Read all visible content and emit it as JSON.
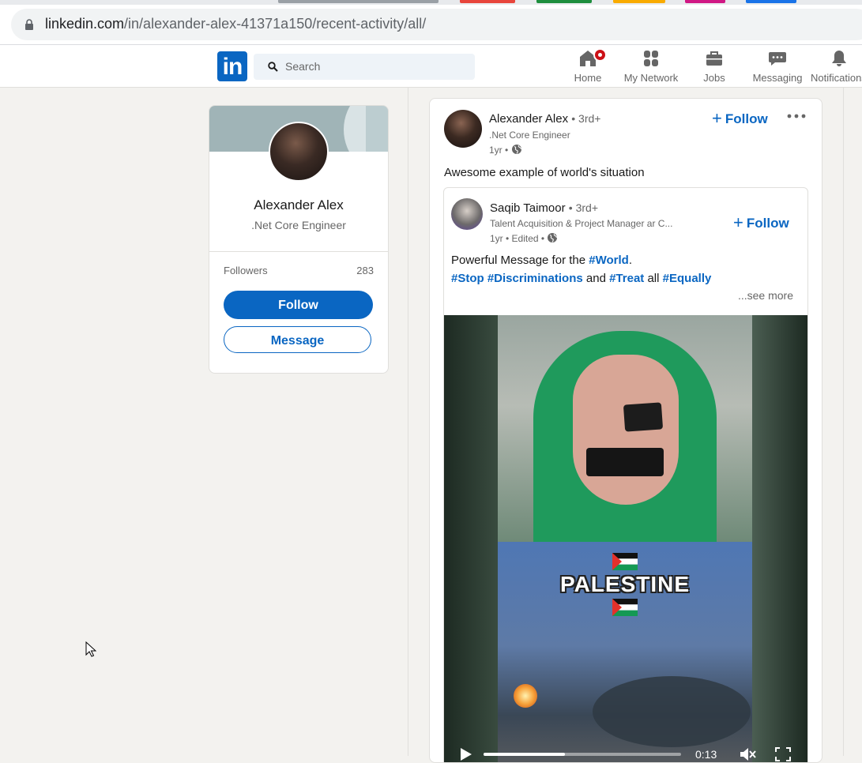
{
  "browser": {
    "url_host": "linkedin.com",
    "url_path": "/in/alexander-alex-41371a150/recent-activity/all/"
  },
  "colors": {
    "brand": "#0a66c2",
    "notification": "#cc1016",
    "background": "#f3f2ef"
  },
  "nav": {
    "search_placeholder": "Search",
    "items": [
      {
        "label": "Home",
        "icon": "home-icon",
        "badge": true
      },
      {
        "label": "My Network",
        "icon": "network-icon"
      },
      {
        "label": "Jobs",
        "icon": "briefcase-icon"
      },
      {
        "label": "Messaging",
        "icon": "messaging-icon"
      },
      {
        "label": "Notifications",
        "icon": "bell-icon"
      }
    ]
  },
  "profile": {
    "name": "Alexander Alex",
    "headline": ".Net Core Engineer",
    "followers_label": "Followers",
    "followers_count": "283",
    "follow_label": "Follow",
    "message_label": "Message"
  },
  "post": {
    "author": "Alexander Alex",
    "degree": "• 3rd+",
    "headline": ".Net Core Engineer",
    "time": "1yr •",
    "follow_label": "Follow",
    "text": "Awesome example of world's situation",
    "reshare": {
      "author": "Saqib Taimoor",
      "degree": "• 3rd+",
      "headline": "Talent Acquisition & Project Manager ar C...",
      "time": "1yr • Edited •",
      "follow_label": "Follow",
      "text_prefix": "Powerful Message for the ",
      "tag_world": "#World",
      "text_period": ".",
      "tag_stop": "#Stop",
      "tag_discriminations": "#Discriminations",
      "text_and": "and",
      "tag_treat": "#Treat",
      "text_all": "all",
      "tag_equally": "#Equally",
      "see_more": "...see more"
    },
    "video": {
      "overlay_text": "PALESTINE",
      "time": "0:13",
      "progress": 0.41
    }
  }
}
